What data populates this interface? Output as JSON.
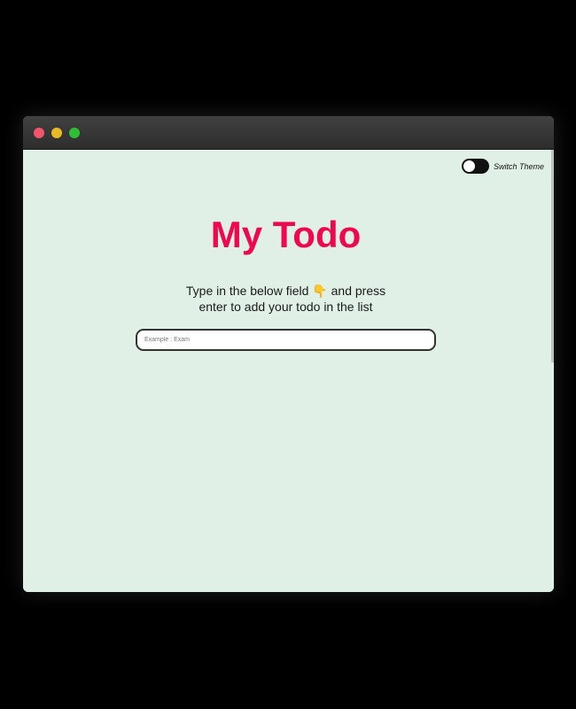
{
  "window": {
    "controls": [
      "close",
      "minimize",
      "maximize"
    ]
  },
  "theme_switch": {
    "label": "Switch Theme",
    "enabled": false
  },
  "header": {
    "title": "My Todo"
  },
  "instructions": {
    "line1_before_icon": "Type in the below field ",
    "pointer_icon": "👇",
    "line1_after_icon": " and press",
    "line2": "enter to add your todo in the list"
  },
  "todo_input": {
    "value": "",
    "placeholder": "Example : Exam"
  },
  "colors": {
    "background": "#e0f0e6",
    "title": "#f0084f",
    "close": "#f2556a",
    "minimize": "#e9b928",
    "maximize": "#2dbf35",
    "toggle": "#111111"
  },
  "icons": {
    "instruction_pointer": "pointing-down-hand-icon",
    "window_close": "close-dot-icon",
    "window_minimize": "minimize-dot-icon",
    "window_maximize": "maximize-dot-icon"
  }
}
